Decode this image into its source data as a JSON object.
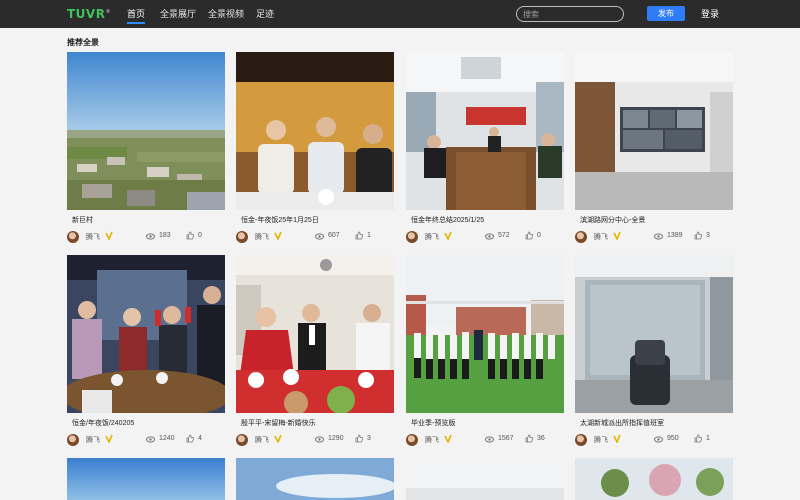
{
  "header": {
    "logo": "TUVR",
    "logo_mark": "®",
    "nav": [
      "首页",
      "全景展厅",
      "全景视频",
      "足迹"
    ],
    "search_placeholder": "搜索",
    "publish_label": "发布",
    "login_label": "登录"
  },
  "section_title": "推荐全景",
  "cards": [
    {
      "title": "新巨村",
      "author": "腾飞",
      "views": "183",
      "likes": "0"
    },
    {
      "title": "恒金-年夜饭25年1月25日",
      "author": "腾飞",
      "views": "607",
      "likes": "1"
    },
    {
      "title": "恒金年终总结2025/1/25",
      "author": "腾飞",
      "views": "572",
      "likes": "0"
    },
    {
      "title": "滨湖路网分中心-全景",
      "author": "腾飞",
      "views": "1389",
      "likes": "3"
    },
    {
      "title": "恒金/年夜饭/240205",
      "author": "腾飞",
      "views": "1240",
      "likes": "4"
    },
    {
      "title": "殷平平-宋留梅-新婚快乐",
      "author": "腾飞",
      "views": "1290",
      "likes": "3"
    },
    {
      "title": "毕业季-预览版",
      "author": "腾飞",
      "views": "1567",
      "likes": "36"
    },
    {
      "title": "太湖新城派出所指挥值班室",
      "author": "腾飞",
      "views": "950",
      "likes": "1"
    }
  ]
}
